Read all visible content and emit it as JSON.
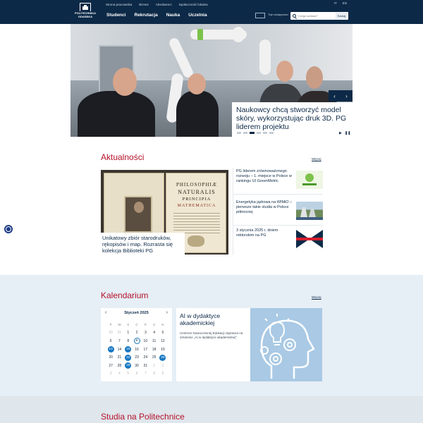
{
  "topnav": [
    "Strona pracownika",
    "Biznes",
    "Absolwenci",
    "Społeczność lokalna"
  ],
  "top_right": [
    "IT",
    "EN"
  ],
  "logo_text": "POLITECHNIKA GDAŃSKA",
  "mainnav": [
    "Studenci",
    "Rekrutacja",
    "Nauka",
    "Uczelnia"
  ],
  "lang_label": "Tryb dostępności",
  "search": {
    "placeholder": "Czego szukasz?",
    "button": "Szukaj"
  },
  "hero": {
    "title": "Naukowcy chcą stworzyć model skóry, wykorzystując druk 3D. PG liderem projektu",
    "prev": "‹",
    "next": "›",
    "active_slide": 3,
    "slide_count": 6,
    "play_icon": "play-icon",
    "pause_icon": "pause-icon"
  },
  "news": {
    "title": "Aktualności",
    "more": "Więcej",
    "main_caption": "Unikatowy zbiór starodruków, rękopisów i map. Rozrasta się kolekcja Biblioteki PG",
    "book_title": [
      "PHILOSOPHIÆ",
      "NATURALIS",
      "PRINCIPIA",
      "MATHEMATICA"
    ],
    "items": [
      {
        "title": "PG liderem zrównoważonego rozwoju – 1. miejsce w Polsce w rankingu UI GreenMetric"
      },
      {
        "title": "Energetyka jądrowa na WIMiO – pierwsze takie studia w Polsce północnej"
      },
      {
        "title": "3 stycznia 2025 r. dniem rektorskim na PG"
      }
    ]
  },
  "calendar": {
    "title": "Kalendarium",
    "more": "Więcej",
    "month": "Styczeń 2025",
    "prev": "‹",
    "next": "›",
    "weekdays": [
      "P",
      "W",
      "Ś",
      "C",
      "P",
      "S",
      "N"
    ],
    "days": [
      [
        "30",
        "muted"
      ],
      [
        "31",
        "muted"
      ],
      [
        "1",
        ""
      ],
      [
        "2",
        ""
      ],
      [
        "3",
        ""
      ],
      [
        "4",
        ""
      ],
      [
        "5",
        ""
      ],
      [
        "6",
        ""
      ],
      [
        "7",
        ""
      ],
      [
        "8",
        ""
      ],
      [
        "9",
        "today"
      ],
      [
        "10",
        ""
      ],
      [
        "11",
        ""
      ],
      [
        "12",
        ""
      ],
      [
        "13",
        "event"
      ],
      [
        "14",
        ""
      ],
      [
        "15",
        "event"
      ],
      [
        "16",
        ""
      ],
      [
        "17",
        ""
      ],
      [
        "18",
        ""
      ],
      [
        "19",
        ""
      ],
      [
        "20",
        ""
      ],
      [
        "21",
        ""
      ],
      [
        "22",
        "event"
      ],
      [
        "23",
        ""
      ],
      [
        "24",
        ""
      ],
      [
        "25",
        ""
      ],
      [
        "26",
        "event"
      ],
      [
        "27",
        ""
      ],
      [
        "28",
        ""
      ],
      [
        "29",
        "event"
      ],
      [
        "30",
        ""
      ],
      [
        "31",
        ""
      ],
      [
        "1",
        "muted"
      ],
      [
        "2",
        "muted"
      ],
      [
        "3",
        "muted"
      ],
      [
        "4",
        "muted"
      ],
      [
        "5",
        "muted"
      ],
      [
        "6",
        "muted"
      ],
      [
        "7",
        "muted"
      ],
      [
        "8",
        "muted"
      ],
      [
        "9",
        "muted"
      ]
    ],
    "event": {
      "title": "AI w dydaktyce akademickiej",
      "description": "Centrum Nowoczesnej Edukacji zaprasza na szkolenie „AI w dydaktyce akademickiej”."
    }
  },
  "study": {
    "title": "Studia na Politechnice"
  },
  "colors": {
    "navy": "#0c2947",
    "accent_red": "#b5122b",
    "event_blue": "#1576c2",
    "calendar_bg": "#e6eef6"
  }
}
